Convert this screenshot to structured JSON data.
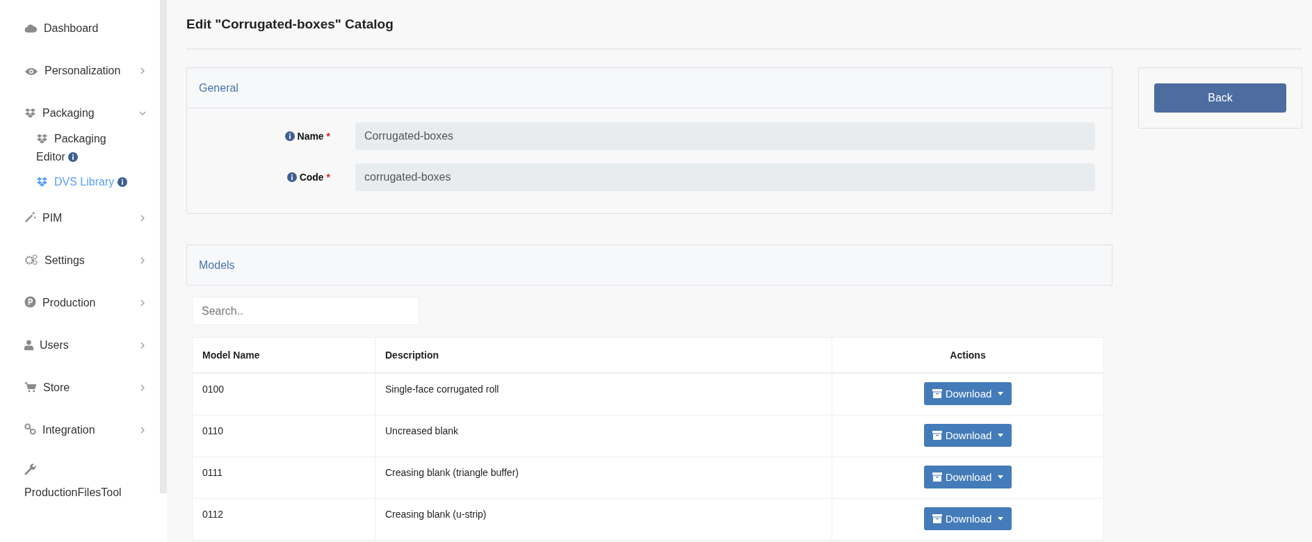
{
  "sidebar": {
    "items": [
      {
        "label": "Dashboard",
        "kind": "link"
      },
      {
        "label": "Personalization",
        "kind": "group",
        "expanded": false
      },
      {
        "label": "Packaging",
        "kind": "group",
        "expanded": true,
        "children": [
          {
            "label": "Packaging Editor",
            "info": true,
            "selected": false
          },
          {
            "label": "DVS Library",
            "info": true,
            "selected": true
          }
        ]
      },
      {
        "label": "PIM",
        "kind": "group",
        "expanded": false
      },
      {
        "label": "Settings",
        "kind": "group",
        "expanded": false
      },
      {
        "label": "Production",
        "kind": "group",
        "expanded": false
      },
      {
        "label": "Users",
        "kind": "group",
        "expanded": false
      },
      {
        "label": "Store",
        "kind": "group",
        "expanded": false
      },
      {
        "label": "Integration",
        "kind": "group",
        "expanded": false
      },
      {
        "label": "ProductionFilesTool",
        "kind": "link"
      }
    ]
  },
  "page": {
    "title": "Edit \"Corrugated-boxes\" Catalog"
  },
  "general": {
    "title": "General",
    "fields": [
      {
        "label": "Name",
        "required_mark": "*",
        "value": "Corrugated-boxes"
      },
      {
        "label": "Code",
        "required_mark": "*",
        "value": "corrugated-boxes"
      }
    ]
  },
  "back_button": "Back",
  "models": {
    "title": "Models",
    "search": {
      "placeholder": "Search.."
    },
    "columns": [
      "Model Name",
      "Description",
      "Actions"
    ],
    "rows": [
      {
        "model_name": "0100",
        "description": "Single-face corrugated roll",
        "action": "Download"
      },
      {
        "model_name": "0110",
        "description": "Uncreased blank",
        "action": "Download"
      },
      {
        "model_name": "0111",
        "description": "Creasing blank (triangle buffer)",
        "action": "Download"
      },
      {
        "model_name": "0112",
        "description": "Creasing blank (u-strip)",
        "action": "Download"
      }
    ]
  }
}
